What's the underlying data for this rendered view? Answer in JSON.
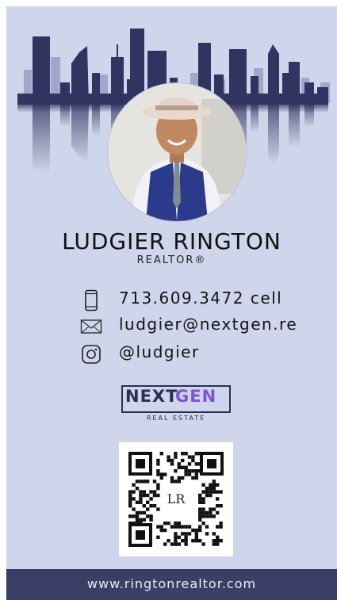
{
  "profile": {
    "name": "LUDGIER RINGTON",
    "title": "REALTOR®"
  },
  "contact": {
    "phone": {
      "icon": "phone-icon",
      "text": "713.609.3472 cell"
    },
    "email": {
      "icon": "envelope-icon",
      "text": "ludgier@nextgen.re"
    },
    "instagram": {
      "icon": "instagram-icon",
      "text": "@ludgier"
    }
  },
  "brand": {
    "logo_part1": "NEXT",
    "logo_part2": "GEN",
    "logo_sub": "REAL ESTATE",
    "qr_monogram": "LR"
  },
  "footer": {
    "url": "www.ringtonrealtor.com"
  },
  "colors": {
    "card_bg": "#cfd5ea",
    "skyline": "#2f3460",
    "logo_primary": "#2b2f55",
    "logo_accent": "#7b54d8",
    "footer_bg": "#3a3f66"
  }
}
